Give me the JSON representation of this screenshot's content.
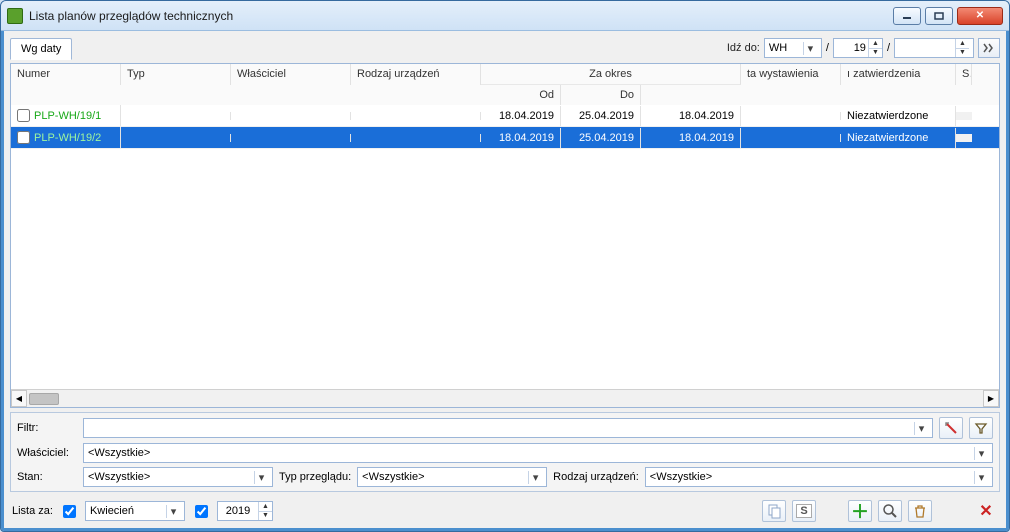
{
  "window": {
    "title": "Lista planów przeglądów technicznych"
  },
  "toolbar": {
    "tab": "Wg daty",
    "goto_label": "Idź do:",
    "goto_sym": "WH",
    "goto_num": "19",
    "goto_slash1": "/",
    "goto_slash2": "/",
    "goto_year": ""
  },
  "grid": {
    "headers": {
      "numer": "Numer",
      "typ": "Typ",
      "wlasciciel": "Właściciel",
      "rodzaj": "Rodzaj urządzeń",
      "zaokres": "Za okres",
      "od": "Od",
      "do": "Do",
      "wyst": "ta wystawienia",
      "zatw": "ı zatwierdzenia",
      "stan": "Stan"
    },
    "rows": [
      {
        "plp": "PLP-WH/19/1",
        "typ": "",
        "wl": "",
        "rodz": "",
        "od": "18.04.2019",
        "do": "25.04.2019",
        "wyst": "18.04.2019",
        "zatw": "",
        "stan": "Niezatwierdzone",
        "selected": false
      },
      {
        "plp": "PLP-WH/19/2",
        "typ": "",
        "wl": "",
        "rodz": "",
        "od": "18.04.2019",
        "do": "25.04.2019",
        "wyst": "18.04.2019",
        "zatw": "",
        "stan": "Niezatwierdzone",
        "selected": true
      }
    ]
  },
  "filter": {
    "filtr_label": "Filtr:",
    "filtr_value": "",
    "wlasciciel_label": "Właściciel:",
    "wlasciciel_value": "<Wszystkie>",
    "stan_label": "Stan:",
    "stan_value": "<Wszystkie>",
    "typ_label": "Typ przeglądu:",
    "typ_value": "<Wszystkie>",
    "rodzaj_label": "Rodzaj urządzeń:",
    "rodzaj_value": "<Wszystkie>"
  },
  "listbar": {
    "listaza_label": "Lista za:",
    "month": "Kwiecień",
    "year": "2019"
  }
}
